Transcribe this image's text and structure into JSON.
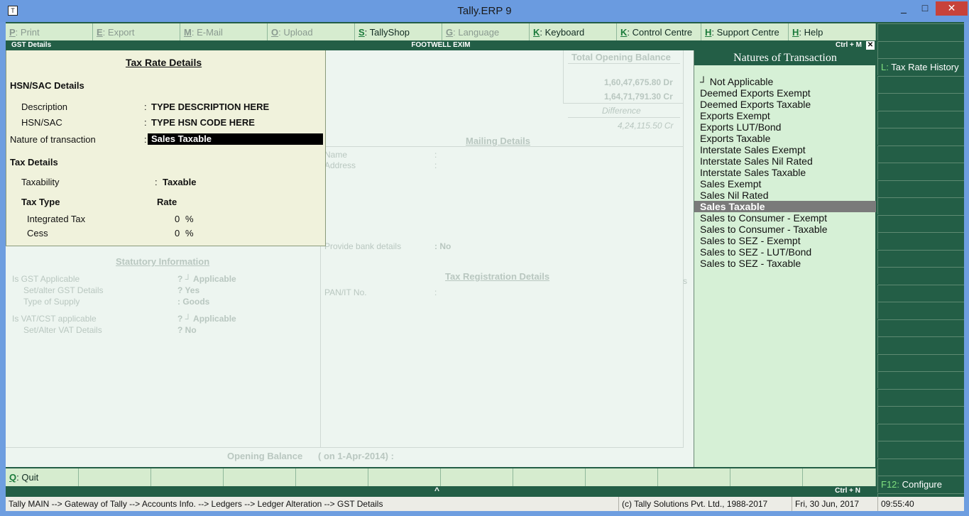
{
  "window": {
    "title": "Tally.ERP 9",
    "min": "_",
    "max": "□",
    "close": "✕",
    "app_icon": "T"
  },
  "topbar": [
    {
      "key": "P",
      "label": ": Print",
      "enabled": false
    },
    {
      "key": "E",
      "label": ": Export",
      "enabled": false
    },
    {
      "key": "M",
      "label": ": E-Mail",
      "enabled": false
    },
    {
      "key": "O",
      "label": ": Upload",
      "enabled": false
    },
    {
      "key": "S",
      "label": ": TallyShop",
      "enabled": true
    },
    {
      "key": "G",
      "label": ": Language",
      "enabled": false
    },
    {
      "key": "K",
      "label": ": Keyboard",
      "enabled": true
    },
    {
      "key": "K",
      "label": ": Control Centre",
      "enabled": true
    },
    {
      "key": "H",
      "label": ": Support Centre",
      "enabled": true
    },
    {
      "key": "H",
      "label": ": Help",
      "enabled": true
    }
  ],
  "header": {
    "left": "GST Details",
    "center": "FOOTWELL EXIM",
    "right": "Ctrl + M",
    "close": "✕"
  },
  "background": {
    "total_opening_balance": "Total Opening Balance",
    "bal1": "1,60,47,675.80 Dr",
    "bal2": "1,64,71,791.30 Cr",
    "difference": "Difference",
    "diff_value": "4,24,115.50 Cr",
    "mailing_details": "Mailing Details",
    "name": "Name",
    "address": "Address",
    "colon": ":",
    "provide_bank": "Provide bank details",
    "provide_bank_val": ": No",
    "tax_reg": "Tax Registration Details",
    "pan": "PAN/IT No.",
    "statutory": "Statutory Information",
    "gst_applicable": "Is GST Applicable",
    "gst_applicable_val": "? ┘ Applicable",
    "set_gst": "Set/alter GST Details",
    "set_gst_val": "? Yes",
    "type_supply": "Type of Supply",
    "type_supply_val": ": Goods",
    "vat_applicable": "Is VAT/CST applicable",
    "vat_applicable_val": "? ┘ Applicable",
    "set_vat": "Set/Alter VAT Details",
    "set_vat_val": "? No",
    "opening_balance": "Opening Balance",
    "opening_balance_date": "( on 1-Apr-2014) :",
    "stray_s": "s"
  },
  "tax_panel": {
    "title": "Tax Rate Details",
    "hsn_header": "HSN/SAC Details",
    "description_label": "Description",
    "description_value": "TYPE DESCRIPTION HERE",
    "hsn_label": "HSN/SAC",
    "hsn_value": "TYPE HSN CODE HERE",
    "nature_label": "Nature of transaction",
    "nature_value": "Sales Taxable",
    "colon": ":",
    "tax_details": "Tax Details",
    "taxability_label": "Taxability",
    "taxability_value": "Taxable",
    "tax_type_header": "Tax Type",
    "rate_header": "Rate",
    "rows": [
      {
        "name": "Integrated Tax",
        "rate": "0",
        "unit": "%"
      },
      {
        "name": "Cess",
        "rate": "0",
        "unit": "%"
      }
    ]
  },
  "natures": {
    "title": "Natures of Transaction",
    "items": [
      "┘  Not Applicable",
      "Deemed Exports Exempt",
      "Deemed Exports Taxable",
      "Exports Exempt",
      "Exports LUT/Bond",
      "Exports Taxable",
      "Interstate Sales Exempt",
      "Interstate Sales Nil Rated",
      "Interstate Sales Taxable",
      "Sales Exempt",
      "Sales Nil Rated",
      "Sales Taxable",
      "Sales to Consumer - Exempt",
      "Sales to Consumer - Taxable",
      "Sales to SEZ - Exempt",
      "Sales to SEZ - LUT/Bond",
      "Sales to SEZ - Taxable"
    ],
    "selected": "Sales Taxable"
  },
  "rightcol": {
    "tax_rate_history_key": "L:",
    "tax_rate_history": " Tax Rate History",
    "configure_key": "F12:",
    "configure": " Configure"
  },
  "bottom": {
    "quit_key": "Q",
    "quit": ": Quit",
    "ctrl_n": "Ctrl + N",
    "up": "^"
  },
  "status": {
    "path": "Tally MAIN --> Gateway of Tally --> Accounts Info. --> Ledgers --> Ledger Alteration --> GST Details",
    "copyright": "(c) Tally Solutions Pvt. Ltd., 1988-2017",
    "date": "Fri, 30 Jun, 2017",
    "time": "09:55:40"
  }
}
